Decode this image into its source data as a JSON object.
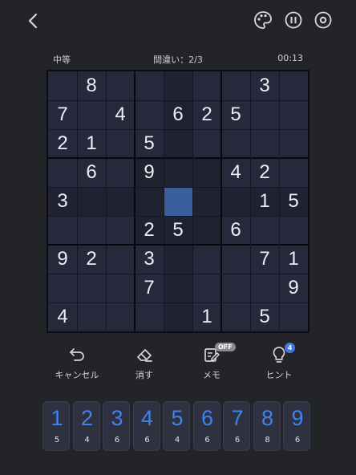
{
  "status": {
    "difficulty": "中等",
    "mistakes": "間違い：2/3",
    "timer": "00:13"
  },
  "board": [
    [
      "",
      "8",
      "",
      "",
      "",
      "",
      "",
      "3",
      ""
    ],
    [
      "7",
      "",
      "4",
      "",
      "6",
      "2",
      "5",
      "",
      ""
    ],
    [
      "2",
      "1",
      "",
      "5",
      "",
      "",
      "",
      "",
      ""
    ],
    [
      "",
      "6",
      "",
      "9",
      "",
      "",
      "4",
      "2",
      ""
    ],
    [
      "3",
      "",
      "",
      "",
      "",
      "",
      "",
      "1",
      "5"
    ],
    [
      "",
      "",
      "",
      "2",
      "5",
      "",
      "6",
      "",
      ""
    ],
    [
      "9",
      "2",
      "",
      "3",
      "",
      "",
      "",
      "7",
      "1"
    ],
    [
      "",
      "",
      "",
      "7",
      "",
      "",
      "",
      "",
      "9"
    ],
    [
      "4",
      "",
      "",
      "",
      "",
      "1",
      "",
      "5",
      ""
    ]
  ],
  "selected_cell": {
    "row": 4,
    "col": 4
  },
  "tools": {
    "undo": "キャンセル",
    "erase": "消す",
    "memo": "メモ",
    "memo_badge": "OFF",
    "hint": "ヒント",
    "hint_badge": "4"
  },
  "numpad": [
    {
      "digit": "1",
      "count": "5"
    },
    {
      "digit": "2",
      "count": "4"
    },
    {
      "digit": "3",
      "count": "6"
    },
    {
      "digit": "4",
      "count": "6"
    },
    {
      "digit": "5",
      "count": "4"
    },
    {
      "digit": "6",
      "count": "6"
    },
    {
      "digit": "7",
      "count": "6"
    },
    {
      "digit": "8",
      "count": "8"
    },
    {
      "digit": "9",
      "count": "6"
    }
  ],
  "icons": [
    "back-icon",
    "palette-icon",
    "pause-icon",
    "settings-icon",
    "undo-icon",
    "eraser-icon",
    "memo-pencil-icon",
    "hint-bulb-icon"
  ],
  "colors": {
    "accent": "#3f83f0",
    "selected_cell": "#3b5f9d",
    "board_bg": "#26283b",
    "page_bg": "#232427"
  }
}
